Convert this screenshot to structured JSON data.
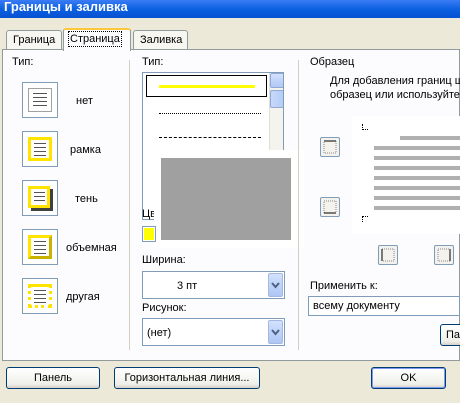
{
  "window": {
    "title": "Границы и заливка"
  },
  "tabs": [
    {
      "label": "Граница",
      "hotkey_index": 0
    },
    {
      "label": "Страница",
      "hotkey_index": 0
    },
    {
      "label": "Заливка",
      "hotkey_index": 0
    }
  ],
  "setting": {
    "label": "Тип:",
    "options": [
      {
        "label": "нет",
        "icon": "none-border-icon"
      },
      {
        "label": "рамка",
        "icon": "box-border-icon"
      },
      {
        "label": "тень",
        "icon": "shadow-border-icon"
      },
      {
        "label": "объемная",
        "icon": "3d-border-icon"
      },
      {
        "label": "другая",
        "icon": "custom-border-icon"
      }
    ]
  },
  "style": {
    "label": "Тип:",
    "color_label": "Цв",
    "color_value": "#ffff00",
    "width_label": "Ширина:",
    "width_value": "3 пт",
    "art_label": "Рисунок:",
    "art_value": "(нет)"
  },
  "preview": {
    "label": "Образец",
    "hint_line1": "Для добавления границ щ",
    "hint_line2": "образец или используйте",
    "apply_label": "Применить к:",
    "apply_value": "всему документу",
    "options_button": "Па"
  },
  "footer": {
    "panel_button": "Панель",
    "hline_button": "Горизонтальная линия...",
    "ok_button": "OK"
  },
  "colors": {
    "accent": "#0a5fe0",
    "selected_line": "#ffff00",
    "overlay": "#a0a0a0"
  }
}
